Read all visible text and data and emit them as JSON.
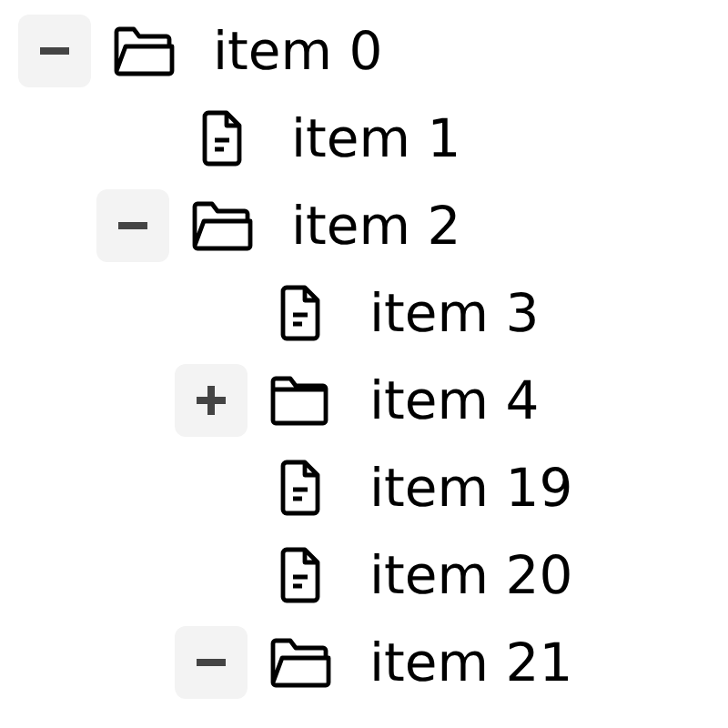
{
  "tree": [
    {
      "label": "item 0",
      "kind": "folder",
      "expanded": true,
      "children": [
        {
          "label": "item 1",
          "kind": "file"
        },
        {
          "label": "item 2",
          "kind": "folder",
          "expanded": true,
          "children": [
            {
              "label": "item 3",
              "kind": "file"
            },
            {
              "label": "item 4",
              "kind": "folder",
              "expanded": false
            },
            {
              "label": "item 19",
              "kind": "file"
            },
            {
              "label": "item 20",
              "kind": "file"
            },
            {
              "label": "item 21",
              "kind": "folder",
              "expanded": true
            }
          ]
        }
      ]
    }
  ]
}
